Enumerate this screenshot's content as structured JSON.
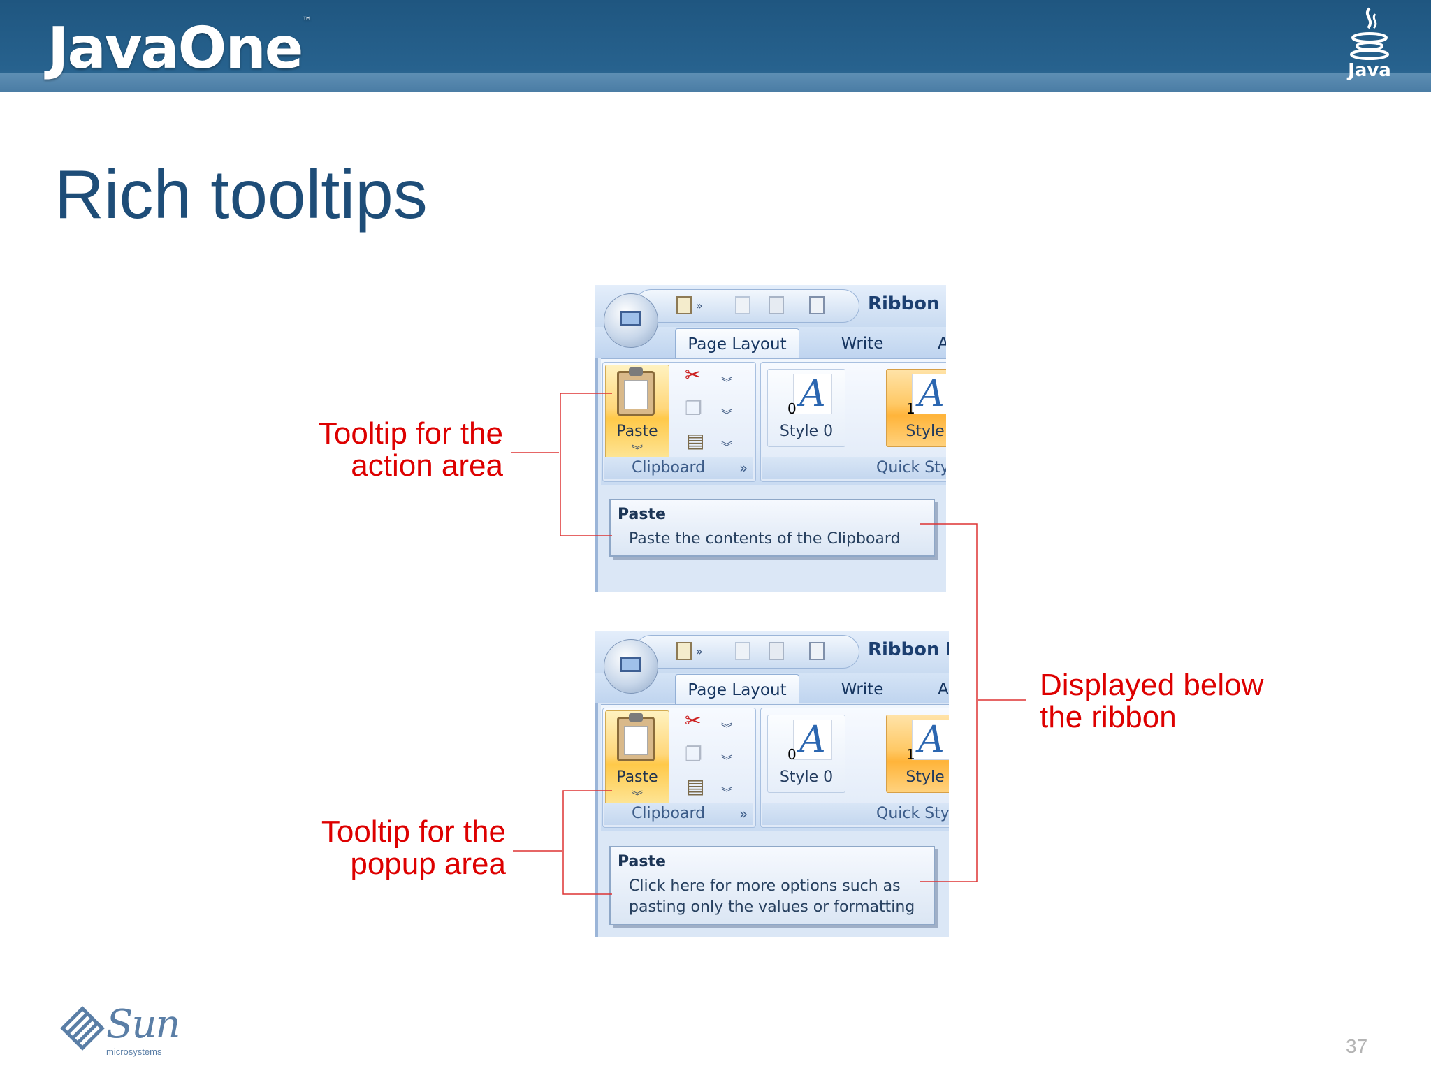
{
  "header": {
    "brand": "JavaOne",
    "brand_tm": "™",
    "java_logo_text": "Java"
  },
  "slide": {
    "title": "Rich tooltips",
    "page_number": "37"
  },
  "footer": {
    "company_logo": "Sun",
    "company_sub": "microsystems"
  },
  "screenshots": [
    {
      "app_title": "Ribbon I",
      "tabs": [
        "Page Layout",
        "Write",
        "A"
      ],
      "paste_label": "Paste",
      "clipboard_group": "Clipboard",
      "styles_group": "Quick Styl",
      "styles": [
        {
          "glyph": "A",
          "num": "0",
          "name": "Style 0"
        },
        {
          "glyph": "A",
          "num": "1",
          "name": "Style"
        }
      ],
      "tooltip": {
        "title": "Paste",
        "body": [
          "Paste the contents of the Clipboard"
        ]
      }
    },
    {
      "app_title": "Ribbon I",
      "tabs": [
        "Page Layout",
        "Write",
        "A"
      ],
      "paste_label": "Paste",
      "clipboard_group": "Clipboard",
      "styles_group": "Quick Style",
      "styles": [
        {
          "glyph": "A",
          "num": "0",
          "name": "Style 0"
        },
        {
          "glyph": "A",
          "num": "1",
          "name": "Style"
        }
      ],
      "tooltip": {
        "title": "Paste",
        "body": [
          "Click here for more options such as",
          "pasting only the values or formatting"
        ]
      }
    }
  ],
  "callouts": {
    "action": [
      "Tooltip for the",
      "action area"
    ],
    "popup": [
      "Tooltip for the",
      "popup area"
    ],
    "below": [
      "Displayed below",
      "the ribbon"
    ]
  },
  "colors": {
    "header_blue": "#27628e",
    "title_blue": "#1e4d78",
    "callout_red": "#dd0000"
  }
}
